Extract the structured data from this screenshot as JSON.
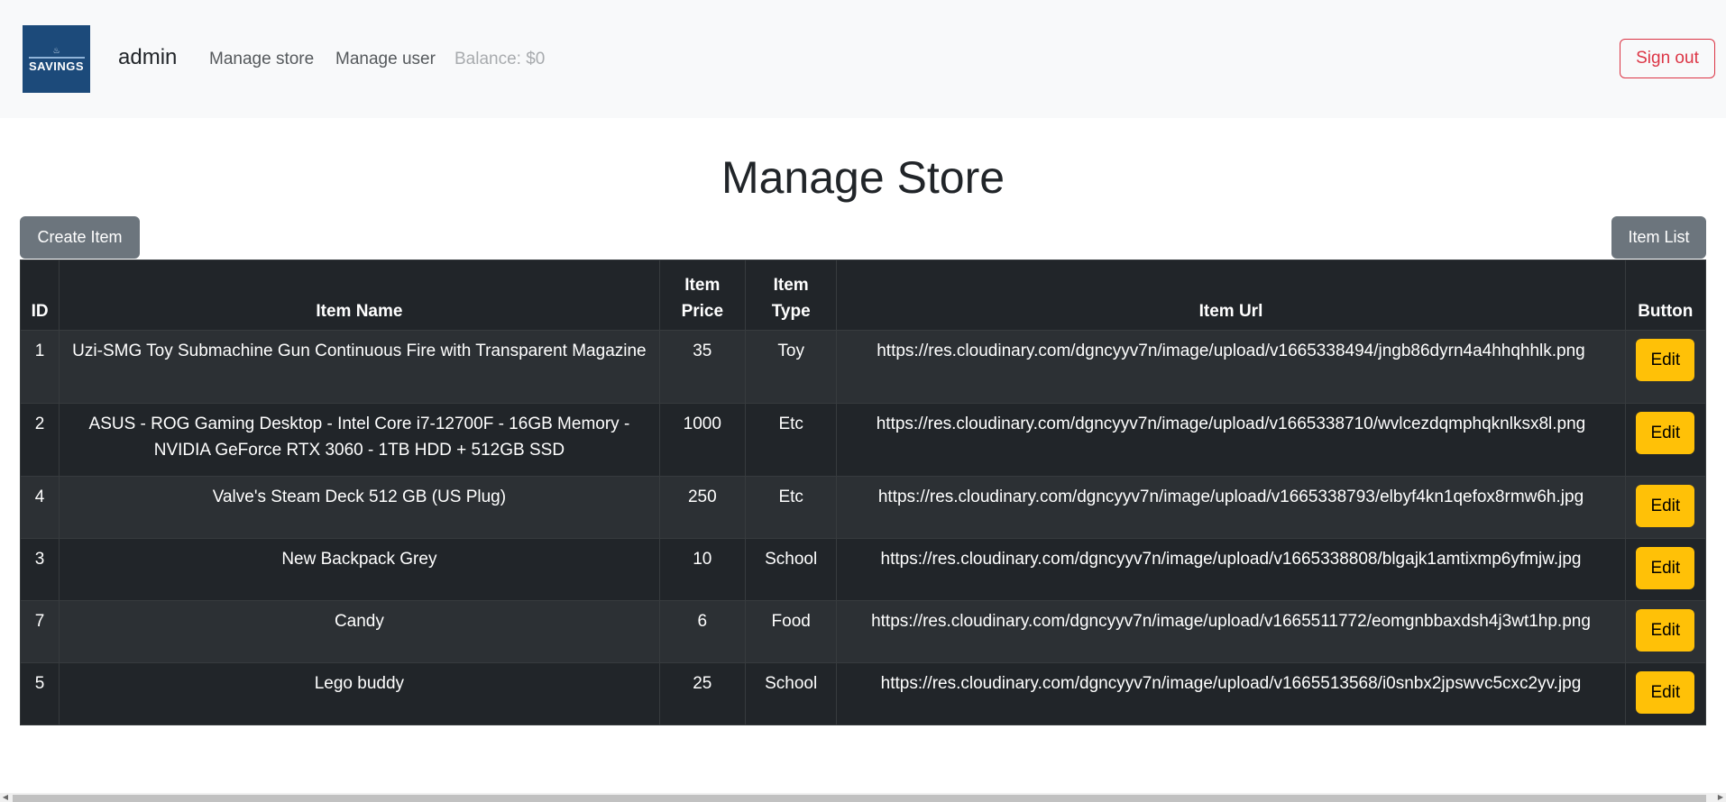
{
  "navbar": {
    "logo": {
      "mark": "♨",
      "text": "SAVINGS",
      "icon": "savings-logo"
    },
    "brand": "admin",
    "links": [
      "Manage store",
      "Manage user"
    ],
    "balance": "Balance: $0",
    "sign_out": "Sign out"
  },
  "main": {
    "title": "Manage Store",
    "create_button": "Create Item",
    "list_button": "Item List"
  },
  "table": {
    "headers": {
      "id": "ID",
      "name": "Item Name",
      "price_line1": "Item",
      "price_line2": "Price",
      "type_line1": "Item",
      "type_line2": "Type",
      "url": "Item Url",
      "button": "Button"
    },
    "rows": [
      {
        "id": "1",
        "name": "Uzi-SMG Toy Submachine Gun Continuous Fire with Transparent Magazine",
        "price": "35",
        "type": "Toy",
        "url": "https://res.cloudinary.com/dgncyyv7n/image/upload/v1665338494/jngb86dyrn4a4hhqhhlk.png",
        "edit": "Edit"
      },
      {
        "id": "2",
        "name": "ASUS - ROG Gaming Desktop - Intel Core i7-12700F - 16GB Memory - NVIDIA GeForce RTX 3060 - 1TB HDD + 512GB SSD",
        "price": "1000",
        "type": "Etc",
        "url": "https://res.cloudinary.com/dgncyyv7n/image/upload/v1665338710/wvlcezdqmphqknlksx8l.png",
        "edit": "Edit"
      },
      {
        "id": "4",
        "name": "Valve's Steam Deck 512 GB (US Plug)",
        "price": "250",
        "type": "Etc",
        "url": "https://res.cloudinary.com/dgncyyv7n/image/upload/v1665338793/elbyf4kn1qefox8rmw6h.jpg",
        "edit": "Edit"
      },
      {
        "id": "3",
        "name": "New Backpack Grey",
        "price": "10",
        "type": "School",
        "url": "https://res.cloudinary.com/dgncyyv7n/image/upload/v1665338808/blgajk1amtixmp6yfmjw.jpg",
        "edit": "Edit"
      },
      {
        "id": "7",
        "name": "Candy",
        "price": "6",
        "type": "Food",
        "url": "https://res.cloudinary.com/dgncyyv7n/image/upload/v1665511772/eomgnbbaxdsh4j3wt1hp.png",
        "edit": "Edit"
      },
      {
        "id": "5",
        "name": "Lego buddy",
        "price": "25",
        "type": "School",
        "url": "https://res.cloudinary.com/dgncyyv7n/image/upload/v1665513568/i0snbx2jpswvc5cxc2yv.jpg",
        "edit": "Edit"
      }
    ]
  },
  "colors": {
    "navbar_bg": "#f8f9fa",
    "logo_bg": "#1c4a7a",
    "signout": "#dc3545",
    "secondary": "#6c757d",
    "table_dark": "#212529",
    "table_stripe": "#2c3034",
    "edit_button": "#ffc107"
  }
}
